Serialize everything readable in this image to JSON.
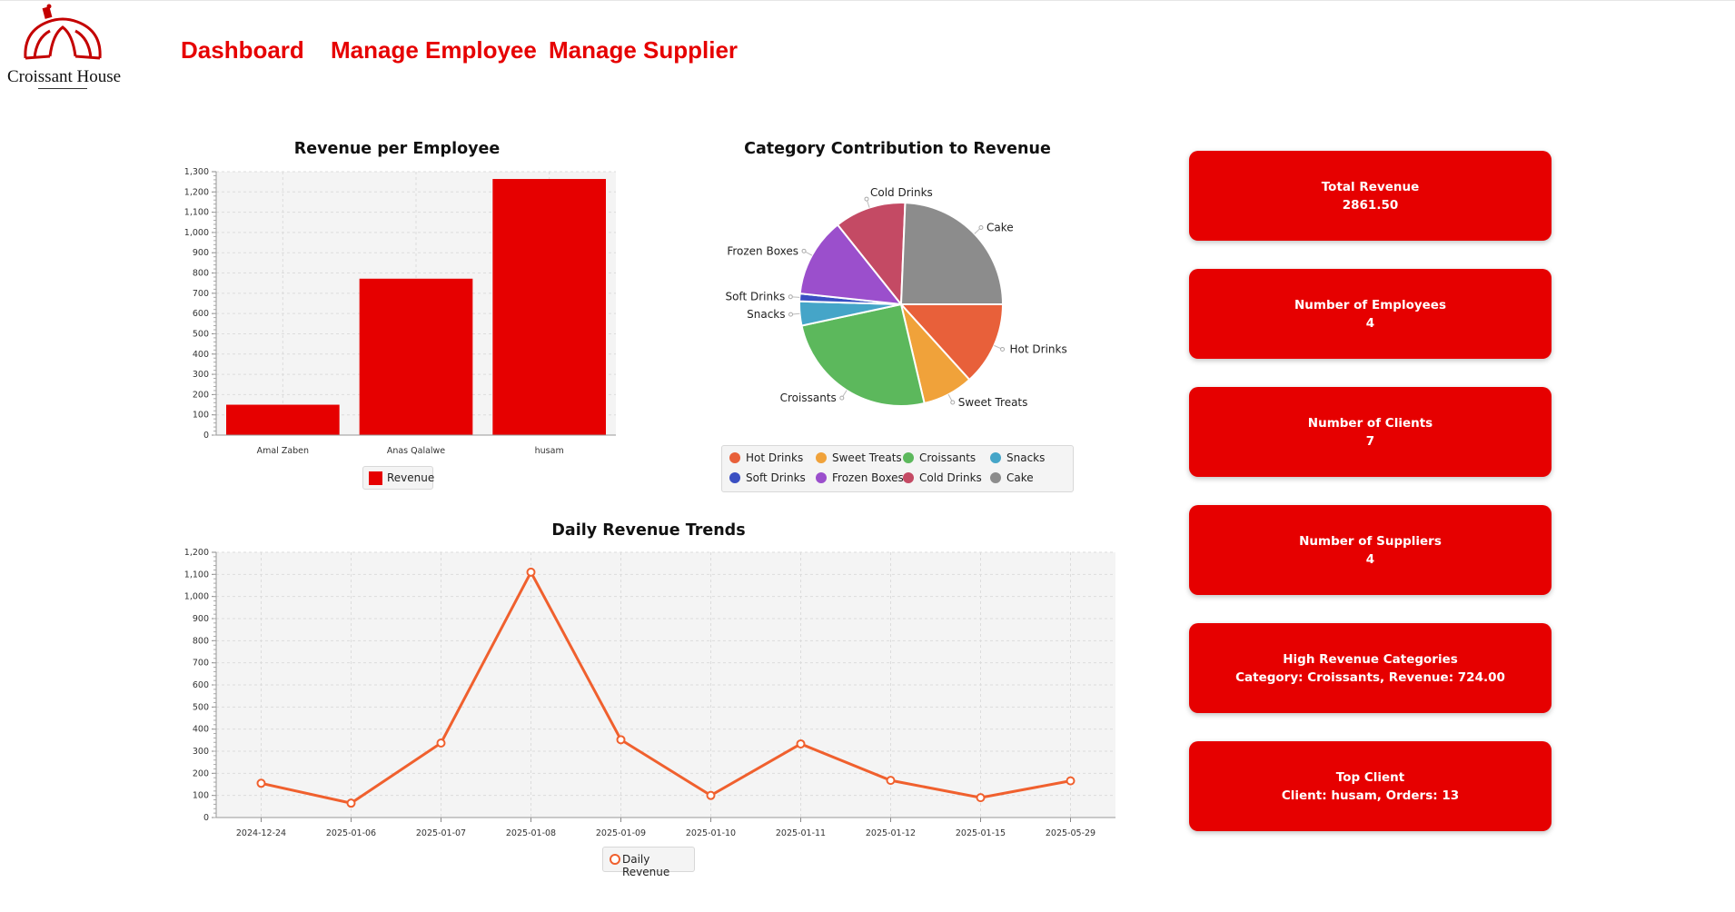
{
  "brand": {
    "logo_text": "Croissant House"
  },
  "nav": {
    "dashboard": "Dashboard",
    "manage_employee": "Manage Employee",
    "manage_supplier": "Manage Supplier"
  },
  "colors": {
    "accent": "#e60000",
    "line": "#f0602e"
  },
  "cards": [
    {
      "label": "Total Revenue",
      "value": "2861.50"
    },
    {
      "label": "Number of Employees",
      "value": "4"
    },
    {
      "label": "Number of Clients",
      "value": "7"
    },
    {
      "label": "Number of Suppliers",
      "value": "4"
    },
    {
      "label": "High Revenue Categories",
      "value": "Category: Croissants, Revenue: 724.00"
    },
    {
      "label": "Top Client",
      "value": "Client: husam, Orders: 13"
    }
  ],
  "chart_data": [
    {
      "type": "bar",
      "title": "Revenue per Employee",
      "categories": [
        "Amal Zaben",
        "Anas Qalalwe",
        "husam"
      ],
      "series": [
        {
          "name": "Revenue",
          "values": [
            150,
            772,
            1264
          ]
        }
      ],
      "ylim": [
        0,
        1300
      ],
      "yticks": [
        "0",
        "100",
        "200",
        "300",
        "400",
        "500",
        "600",
        "700",
        "800",
        "900",
        "1,000",
        "1,100",
        "1,200",
        "1,300"
      ],
      "grid": true,
      "legend_position": "bottom",
      "color": "#e60000"
    },
    {
      "type": "pie",
      "title": "Category Contribution to Revenue",
      "slices": [
        {
          "label": "Hot Drinks",
          "value": 380,
          "color": "#e8603a"
        },
        {
          "label": "Sweet Treats",
          "value": 230,
          "color": "#f0a23a"
        },
        {
          "label": "Croissants",
          "value": 724,
          "color": "#5cb85c"
        },
        {
          "label": "Snacks",
          "value": 110,
          "color": "#45a5c8"
        },
        {
          "label": "Soft Drinks",
          "value": 35,
          "color": "#3a4fc2"
        },
        {
          "label": "Frozen Boxes",
          "value": 360,
          "color": "#9b4fcc"
        },
        {
          "label": "Cold Drinks",
          "value": 325,
          "color": "#c44a64"
        },
        {
          "label": "Cake",
          "value": 697,
          "color": "#8c8c8c"
        }
      ],
      "legend_position": "bottom"
    },
    {
      "type": "line",
      "title": "Daily Revenue Trends",
      "x": [
        "2024-12-24",
        "2025-01-06",
        "2025-01-07",
        "2025-01-08",
        "2025-01-09",
        "2025-01-10",
        "2025-01-11",
        "2025-01-12",
        "2025-01-15",
        "2025-05-29"
      ],
      "series": [
        {
          "name": "Daily Revenue",
          "values": [
            155,
            65,
            337,
            1110,
            352,
            100,
            333,
            168,
            90,
            166
          ]
        }
      ],
      "ylim": [
        0,
        1200
      ],
      "yticks": [
        "0",
        "100",
        "200",
        "300",
        "400",
        "500",
        "600",
        "700",
        "800",
        "900",
        "1,000",
        "1,100",
        "1,200"
      ],
      "grid": true,
      "legend_position": "bottom",
      "color": "#f0602e"
    }
  ]
}
